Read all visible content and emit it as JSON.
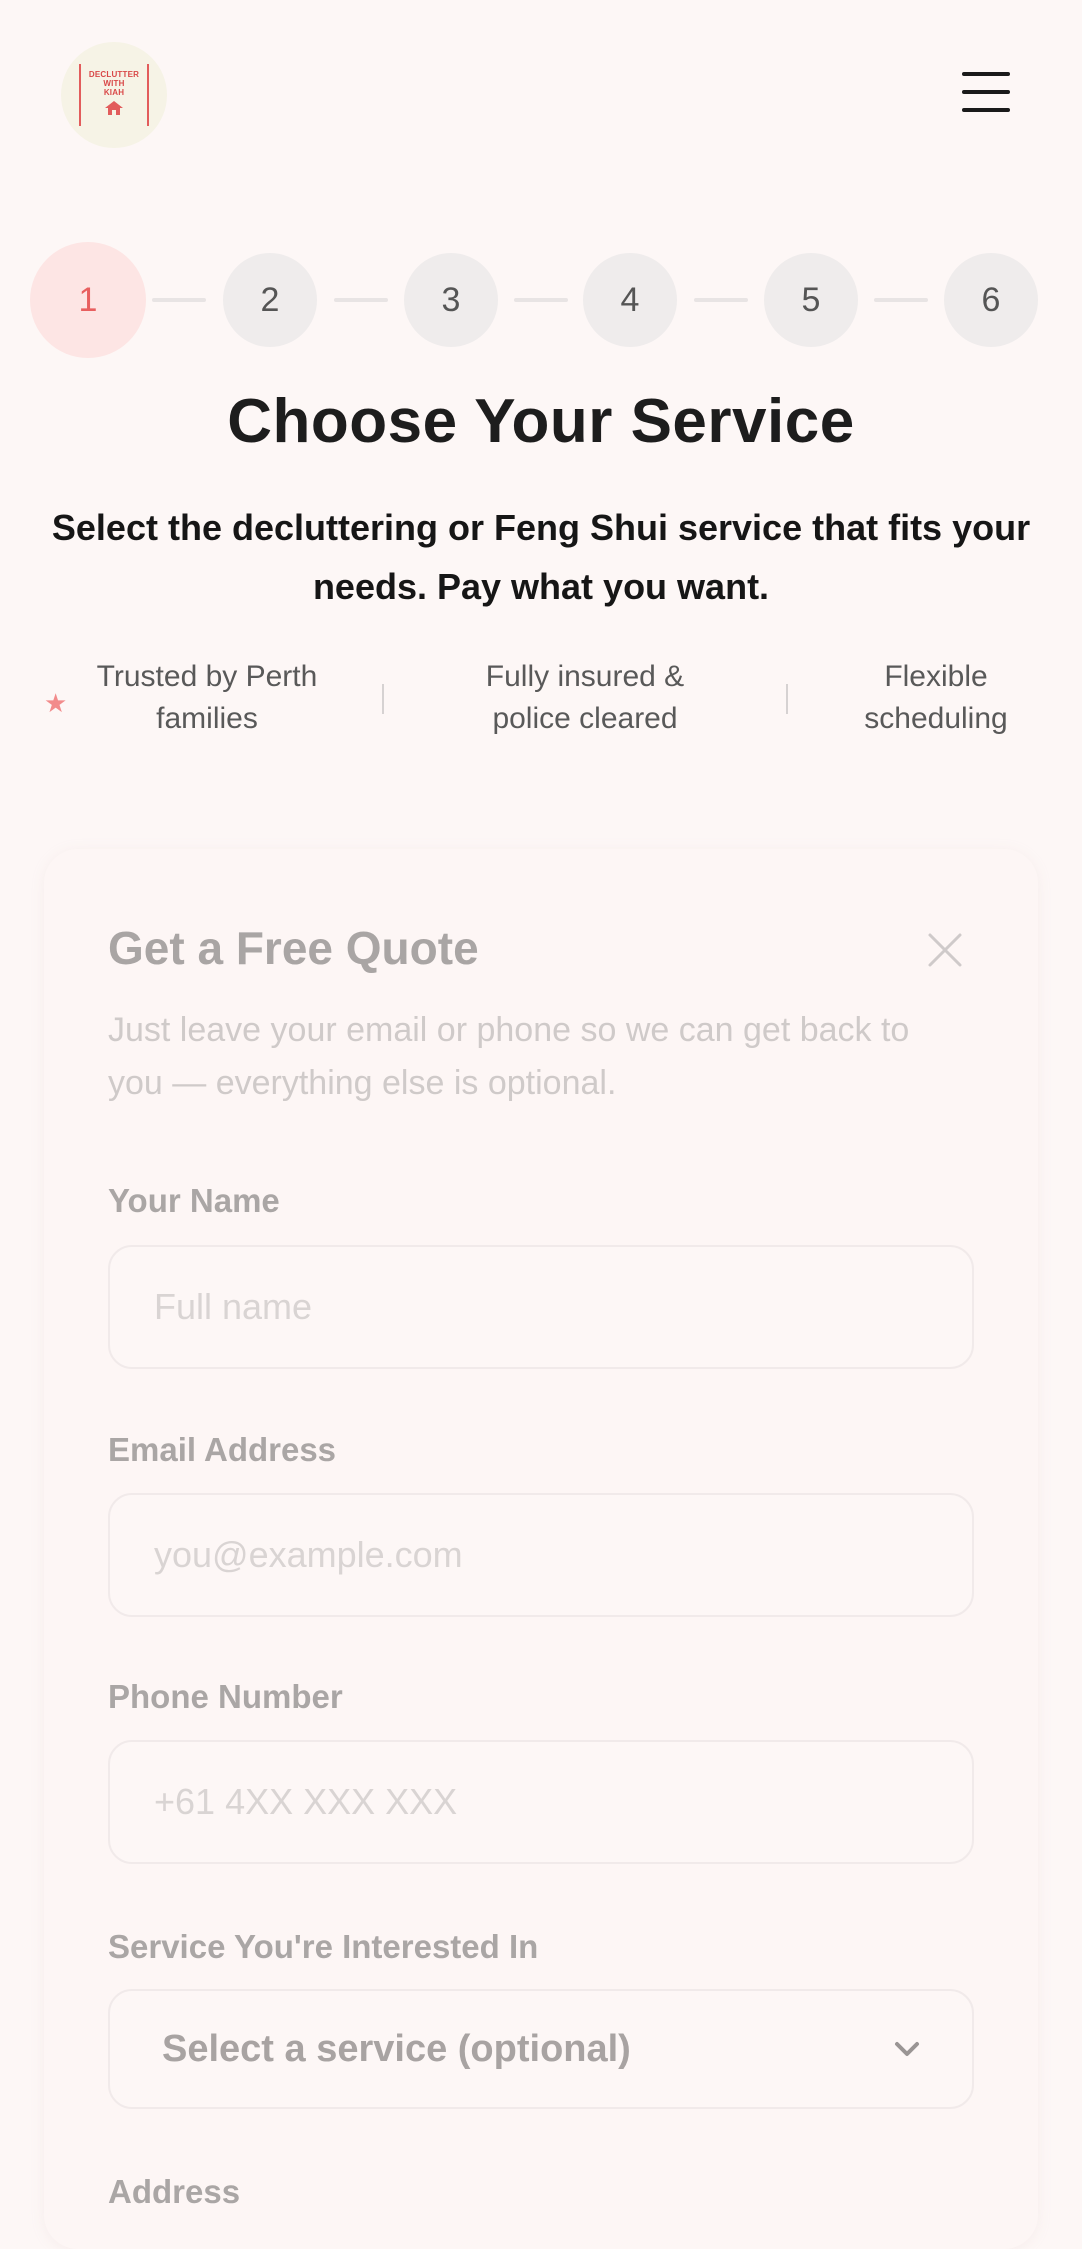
{
  "header": {
    "logo_text_lines": [
      "DECLUTTER",
      "WITH",
      "KIAH"
    ],
    "menu_icon": "hamburger-menu-icon"
  },
  "stepper": {
    "steps": [
      "1",
      "2",
      "3",
      "4",
      "5",
      "6"
    ],
    "active_step": 1
  },
  "page": {
    "title": "Choose Your Service",
    "subtitle": "Select the decluttering or Feng Shui service that fits your needs. Pay what you want."
  },
  "trust": [
    {
      "line1": "Trusted by Perth",
      "line2": "families"
    },
    {
      "line1": "Fully insured &",
      "line2": "police cleared"
    },
    {
      "line1": "Flexible",
      "line2": "scheduling"
    }
  ],
  "quote_form": {
    "title": "Get a Free Quote",
    "description": "Just leave your email or phone so we can get back to you — everything else is optional.",
    "fields": {
      "name": {
        "label": "Your Name",
        "placeholder": "Full name",
        "value": ""
      },
      "email": {
        "label": "Email Address",
        "placeholder": "you@example.com",
        "value": ""
      },
      "phone": {
        "label": "Phone Number",
        "placeholder": "+61 4XX XXX XXX",
        "value": ""
      },
      "service": {
        "label": "Service You're Interested In",
        "selected": "Select a service (optional)"
      },
      "address": {
        "label": "Address"
      }
    }
  },
  "colors": {
    "accent": "#e85f5f",
    "accent_soft": "#fde5e4",
    "background": "#fdf7f6"
  }
}
